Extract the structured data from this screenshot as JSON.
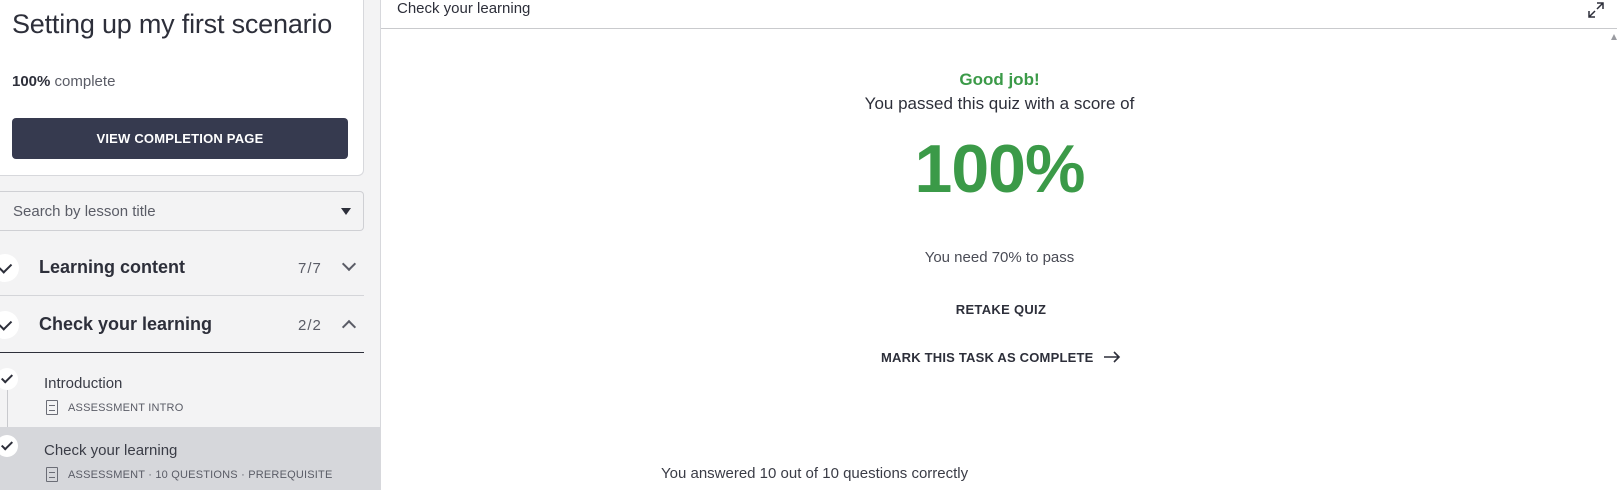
{
  "sidebar": {
    "course_title": "Setting up my first scenario",
    "progress_value": "100%",
    "progress_suffix": "complete",
    "completion_button": "VIEW COMPLETION PAGE",
    "search_placeholder": "Search by lesson title",
    "sections": [
      {
        "label": "Learning content",
        "count": "7/7",
        "expanded": false
      },
      {
        "label": "Check your learning",
        "count": "2/2",
        "expanded": true
      }
    ],
    "lessons": [
      {
        "title": "Introduction",
        "meta": "ASSESSMENT INTRO",
        "completed": true,
        "active": false
      },
      {
        "title": "Check your learning",
        "meta": "ASSESSMENT · 10 QUESTIONS · PREREQUISITE",
        "completed": true,
        "active": true
      }
    ]
  },
  "main": {
    "header_title": "Check your learning",
    "result": {
      "headline": "Good job!",
      "passed_text": "You passed this quiz with a score of",
      "score": "100%",
      "pass_requirement": "You need 70% to pass",
      "retake_label": "RETAKE QUIZ",
      "mark_complete_label": "MARK THIS TASK AS COMPLETE",
      "answered_summary": "You answered 10 out of 10 questions correctly"
    }
  },
  "icons": {
    "expand": "expand-icon",
    "check": "check-icon",
    "chevron": "chevron-icon",
    "lesson": "lesson-doc-icon",
    "arrow": "arrow-right-icon"
  },
  "colors": {
    "success_green": "#3b9a48",
    "primary_button": "#363a4f",
    "active_lesson_bg": "#d6d7db"
  }
}
